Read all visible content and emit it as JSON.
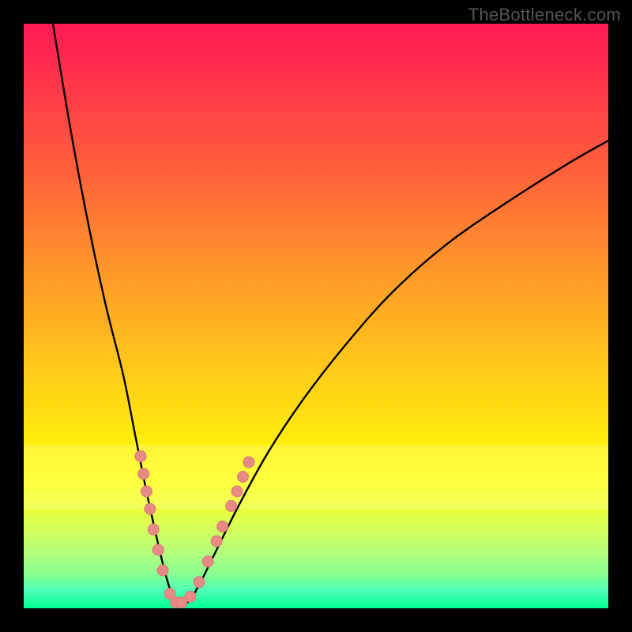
{
  "watermark": "TheBottleneck.com",
  "colors": {
    "frame": "#000000",
    "curve_stroke": "#000000",
    "marker_fill": "#e78a85",
    "marker_stroke": "#d87a75"
  },
  "chart_data": {
    "type": "line",
    "title": "",
    "xlabel": "",
    "ylabel": "",
    "xlim": [
      0,
      100
    ],
    "ylim": [
      0,
      100
    ],
    "grid": false,
    "legend": false,
    "note": "V-shaped bottleneck curve on a red→green vertical gradient background. Values are approximate, read from pixel positions (no axis ticks/labels present).",
    "series": [
      {
        "name": "bottleneck-curve",
        "x": [
          5,
          8,
          11,
          14,
          17,
          19,
          21,
          23,
          24.5,
          26,
          28,
          30,
          33,
          37,
          42,
          48,
          55,
          63,
          72,
          82,
          93,
          100
        ],
        "y": [
          100,
          82,
          66,
          52,
          40,
          30,
          20,
          11,
          5,
          1,
          1,
          4,
          10,
          18,
          27,
          36,
          45,
          54,
          62,
          69,
          76,
          80
        ]
      }
    ],
    "markers": [
      {
        "x": 20.0,
        "y": 26.0
      },
      {
        "x": 20.5,
        "y": 23.0
      },
      {
        "x": 21.0,
        "y": 20.0
      },
      {
        "x": 21.6,
        "y": 17.0
      },
      {
        "x": 22.2,
        "y": 13.5
      },
      {
        "x": 23.0,
        "y": 10.0
      },
      {
        "x": 23.8,
        "y": 6.5
      },
      {
        "x": 25.0,
        "y": 2.5
      },
      {
        "x": 26.0,
        "y": 1.0
      },
      {
        "x": 27.0,
        "y": 1.0
      },
      {
        "x": 28.5,
        "y": 2.0
      },
      {
        "x": 30.0,
        "y": 4.5
      },
      {
        "x": 31.5,
        "y": 8.0
      },
      {
        "x": 33.0,
        "y": 11.5
      },
      {
        "x": 34.0,
        "y": 14.0
      },
      {
        "x": 35.5,
        "y": 17.5
      },
      {
        "x": 36.5,
        "y": 20.0
      },
      {
        "x": 37.5,
        "y": 22.5
      },
      {
        "x": 38.5,
        "y": 25.0
      }
    ],
    "marker_radius_px": 7
  }
}
